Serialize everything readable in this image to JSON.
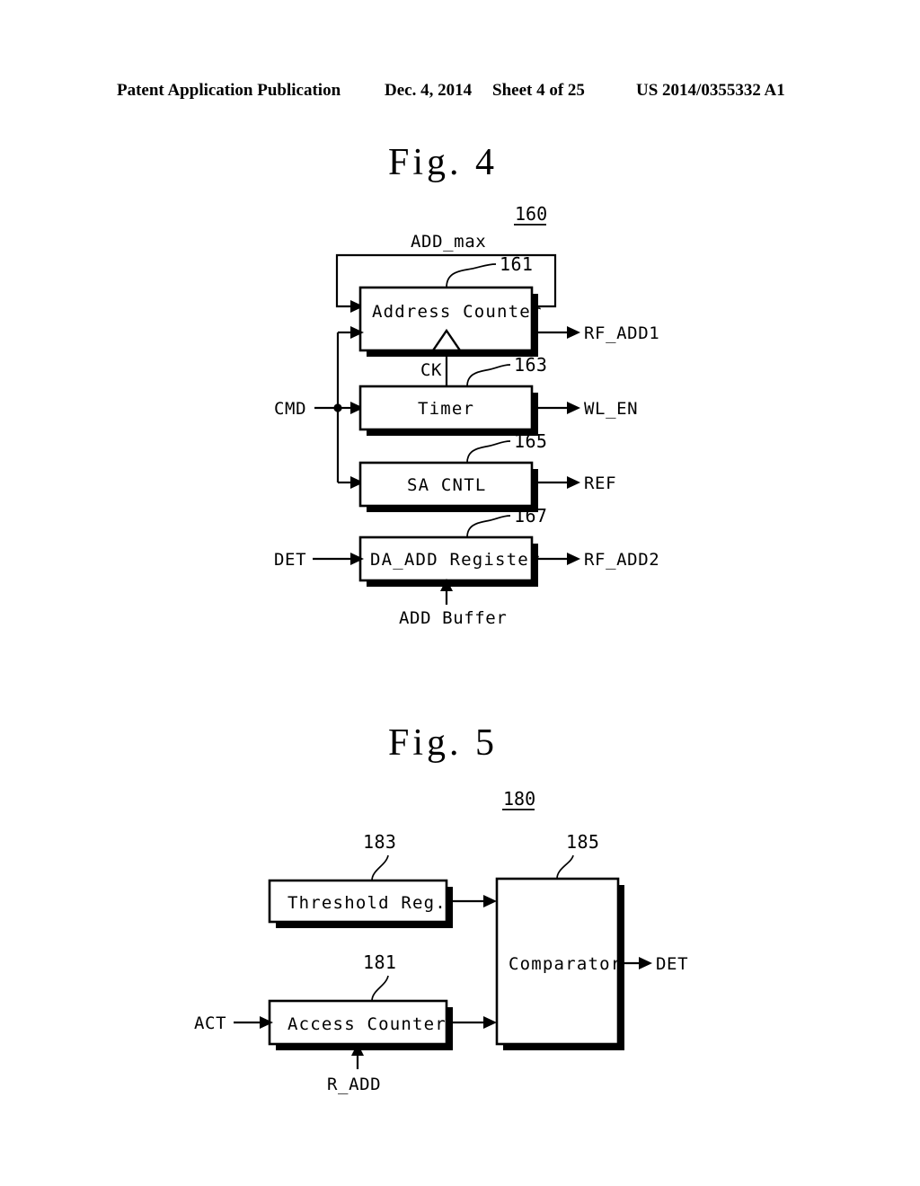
{
  "header": {
    "publication": "Patent Application Publication",
    "date": "Dec. 4, 2014",
    "sheet": "Sheet 4 of 25",
    "document_number": "US 2014/0355332 A1"
  },
  "figures": [
    {
      "title": "Fig. 4",
      "assembly_ref": "160",
      "blocks": [
        {
          "label": "Address Counter",
          "ref": "161"
        },
        {
          "label": "Timer",
          "ref": "163"
        },
        {
          "label": "SA CNTL",
          "ref": "165"
        },
        {
          "label": "DA_ADD Register",
          "ref": "167"
        }
      ],
      "signals": {
        "add_max": "ADD_max",
        "cmd": "CMD",
        "ck": "CK",
        "det": "DET",
        "add_buffer": "ADD Buffer",
        "rf_add1": "RF_ADD1",
        "wl_en": "WL_EN",
        "ref": "REF",
        "rf_add2": "RF_ADD2"
      }
    },
    {
      "title": "Fig. 5",
      "assembly_ref": "180",
      "blocks": [
        {
          "label": "Threshold Reg.",
          "ref": "183"
        },
        {
          "label": "Access Counter",
          "ref": "181"
        },
        {
          "label": "Comparator",
          "ref": "185"
        }
      ],
      "signals": {
        "act": "ACT",
        "r_add": "R_ADD",
        "det": "DET"
      }
    }
  ],
  "colors": {
    "ink": "#000000",
    "paper": "#ffffff"
  }
}
